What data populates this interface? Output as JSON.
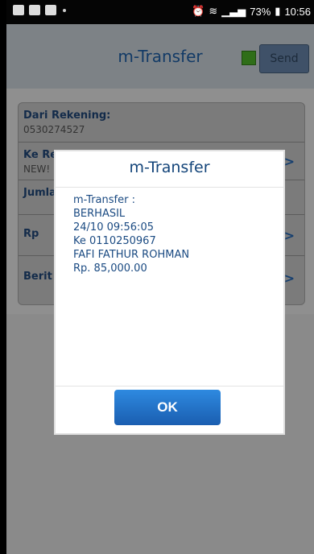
{
  "status_bar": {
    "battery": "73%",
    "time": "10:56"
  },
  "app_bar": {
    "title": "m-Transfer",
    "send_label": "Send"
  },
  "form": {
    "from_account_label": "Dari Rekening:",
    "from_account_value": "0530274527",
    "to_account_label_partial": "Ke Re",
    "to_account_value_partial": "NEW!",
    "amount_label_partial": "Jumla",
    "currency_label": "Rp",
    "message_label_partial": "Berit"
  },
  "dialog": {
    "title": "m-Transfer",
    "lines": [
      "m-Transfer :",
      "BERHASIL",
      "24/10 09:56:05",
      "Ke 0110250967",
      "FAFI FATHUR ROHMAN",
      "Rp. 85,000.00"
    ],
    "ok_label": "OK"
  }
}
